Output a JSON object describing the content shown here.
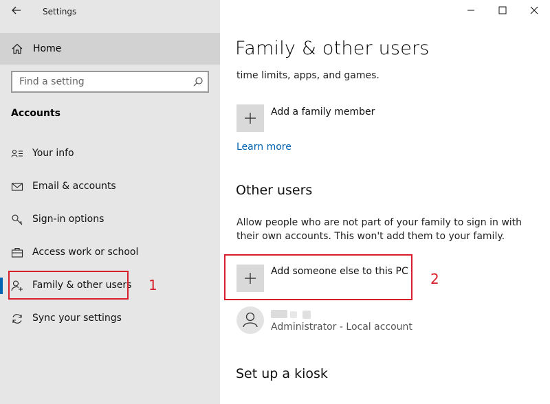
{
  "window": {
    "title": "Settings"
  },
  "sidebar": {
    "home_label": "Home",
    "search_placeholder": "Find a setting",
    "section": "Accounts",
    "items": [
      {
        "label": "Your info",
        "icon": "contact-card-icon"
      },
      {
        "label": "Email & accounts",
        "icon": "mail-icon"
      },
      {
        "label": "Sign-in options",
        "icon": "key-icon"
      },
      {
        "label": "Access work or school",
        "icon": "briefcase-icon"
      },
      {
        "label": "Family & other users",
        "icon": "add-user-icon",
        "active": true
      },
      {
        "label": "Sync your settings",
        "icon": "sync-icon"
      }
    ]
  },
  "main": {
    "title": "Family & other users",
    "family_desc": "time limits, apps, and games.",
    "add_family_label": "Add a family member",
    "learn_more": "Learn more",
    "other_users_heading": "Other users",
    "other_users_desc": "Allow people who are not part of your family to sign in with their own accounts. This won't add them to your family.",
    "add_someone_label": "Add someone else to this PC",
    "account": {
      "type": "Administrator - Local account"
    },
    "kiosk_heading": "Set up a kiosk"
  },
  "annotations": {
    "step1": "1",
    "step2": "2"
  },
  "colors": {
    "accent": "#0063b1",
    "highlight": "#d81e2b",
    "sidebar_bg": "#e6e6e6"
  }
}
